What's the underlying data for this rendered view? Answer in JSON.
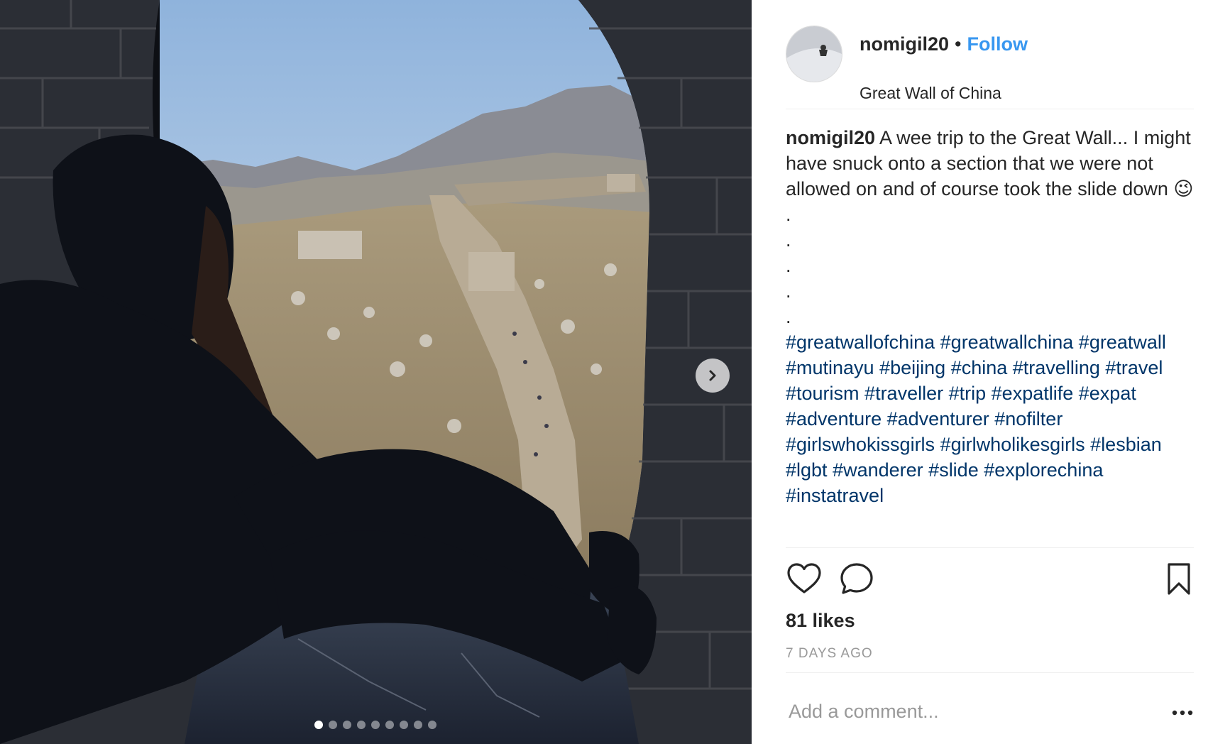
{
  "post": {
    "username": "nomigil20",
    "separator": "•",
    "follow_label": "Follow",
    "location": "Great Wall of China",
    "caption": {
      "username": "nomigil20",
      "text": "A wee trip to the Great Wall... I might have snuck onto a section that we were not allowed on and of course took the slide down 😉",
      "dots": [
        ".",
        ".",
        ".",
        ".",
        "."
      ],
      "hashtags": [
        "#greatwallofchina",
        "#greatwallchina",
        "#greatwall",
        "#mutinayu",
        "#beijing",
        "#china",
        "#travelling",
        "#travel",
        "#tourism",
        "#traveller",
        "#trip",
        "#expatlife",
        "#expat",
        "#adventure",
        "#adventurer",
        "#nofilter",
        "#girlswhokissgirls",
        "#girlwholikesgirls",
        "#lesbian",
        "#lgbt",
        "#wanderer",
        "#slide",
        "#explorechina",
        "#instatravel"
      ]
    },
    "likes": "81 likes",
    "timestamp": "7 DAYS AGO",
    "comment_placeholder": "Add a comment...",
    "carousel": {
      "count": 9,
      "active_index": 0
    }
  },
  "icons": {
    "next": "chevron-right-icon",
    "like": "heart-outline-icon",
    "comment": "speech-bubble-icon",
    "save": "bookmark-outline-icon",
    "more": "more-dots-icon"
  },
  "colors": {
    "follow": "#3897f0",
    "hashtag": "#003569",
    "text": "#262626",
    "muted": "#999999"
  }
}
